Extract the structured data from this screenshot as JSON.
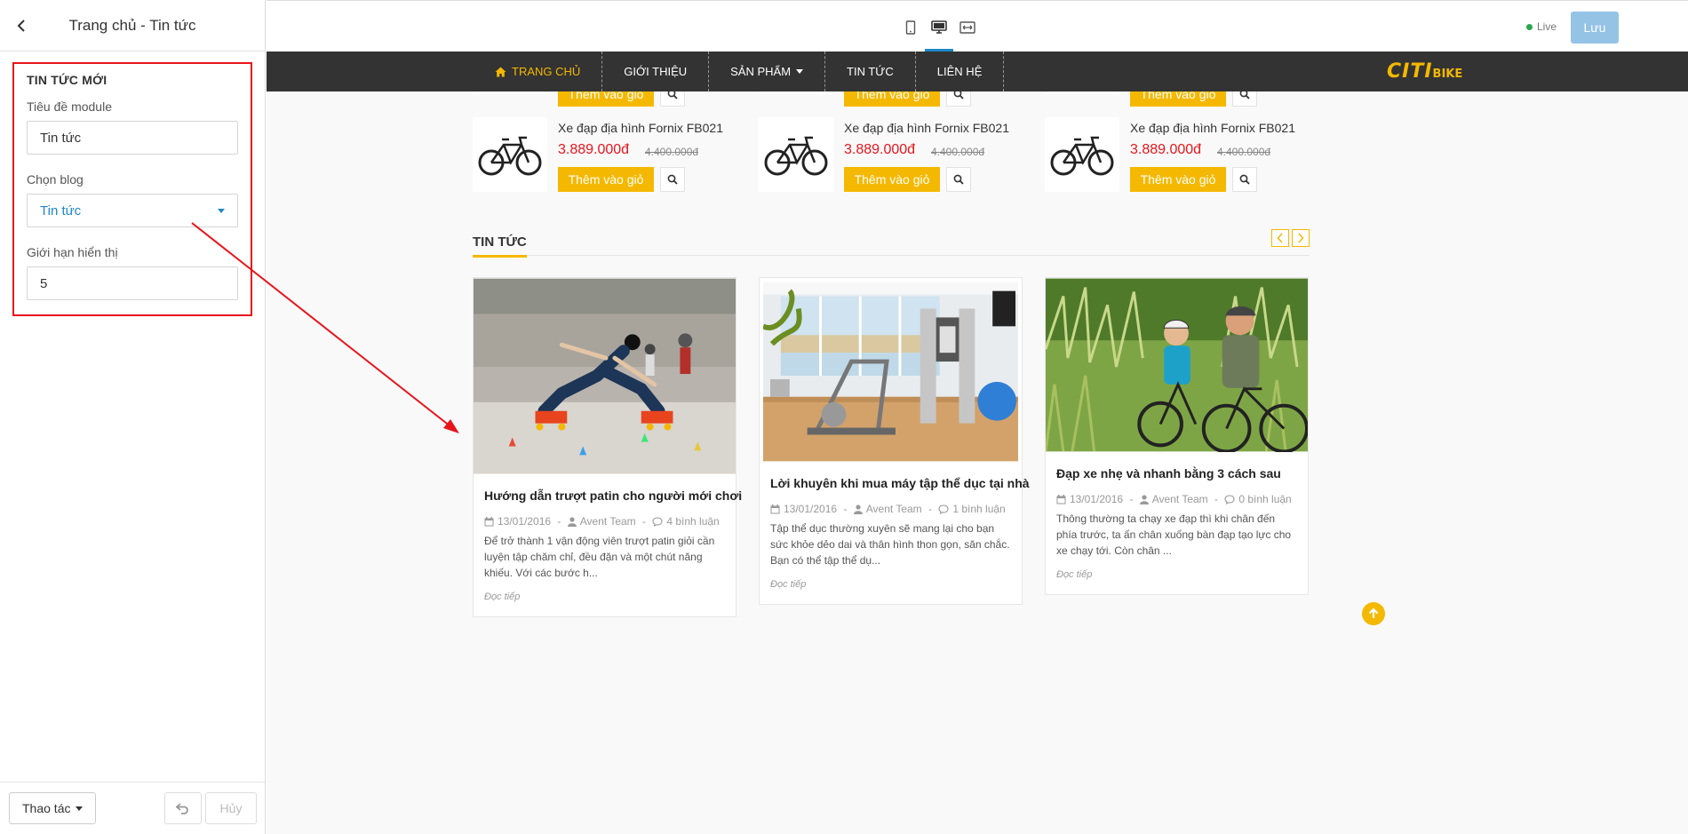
{
  "editor": {
    "title": "Trang chủ - Tin tức",
    "section_title": "TIN TỨC MỚI",
    "fields": {
      "module_title_label": "Tiêu đề module",
      "module_title_value": "Tin tức",
      "blog_label": "Chọn blog",
      "blog_value": "Tin tức",
      "limit_label": "Giới hạn hiển thị",
      "limit_value": "5"
    },
    "footer": {
      "action_label": "Thao tác",
      "cancel_label": "Hủy"
    }
  },
  "toolbar": {
    "status": "Live",
    "save_label": "Lưu"
  },
  "site": {
    "nav": [
      {
        "label": "TRANG CHỦ",
        "active": true
      },
      {
        "label": "GIỚI THIỆU"
      },
      {
        "label": "SẢN PHẨM",
        "dropdown": true
      },
      {
        "label": "TIN TỨC"
      },
      {
        "label": "LIÊN HỆ"
      }
    ],
    "logo": {
      "part1": "CITI",
      "part2": "BIKE"
    },
    "products_top": [
      {
        "button": "Thêm vào giỏ"
      },
      {
        "button": "Thêm vào giỏ"
      },
      {
        "button": "Thêm vào giỏ"
      }
    ],
    "products": [
      {
        "name": "Xe đạp địa hình Fornix FB021",
        "price": "3.889.000đ",
        "old_price": "4.400.000đ",
        "button": "Thêm vào giỏ"
      },
      {
        "name": "Xe đạp địa hình Fornix FB021",
        "price": "3.889.000đ",
        "old_price": "4.400.000đ",
        "button": "Thêm vào giỏ"
      },
      {
        "name": "Xe đạp địa hình Fornix FB021",
        "price": "3.889.000đ",
        "old_price": "4.400.000đ",
        "button": "Thêm vào giỏ"
      }
    ],
    "news_title": "TIN TỨC",
    "articles": [
      {
        "title": "Hướng dẫn trượt patin cho người mới chơi",
        "date": "13/01/2016",
        "author": "Avent Team",
        "comments": "4 bình luận",
        "excerpt": "Để trở thành 1 vận động viên trượt patin giỏi cần luyện tập chăm chỉ, đều đặn và một chút năng khiếu. Với các bước h...",
        "more": "Đọc tiếp"
      },
      {
        "title": "Lời khuyên khi mua máy tập thể dục tại nhà",
        "date": "13/01/2016",
        "author": "Avent Team",
        "comments": "1 bình luận",
        "excerpt": "Tập thể dục thường xuyên sẽ mang lại cho bạn sức khỏe dẻo dai và thân hình thon gọn, săn chắc. Bạn có thể tập thể dụ...",
        "more": "Đọc tiếp"
      },
      {
        "title": "Đạp xe nhẹ và nhanh bằng 3 cách sau",
        "date": "13/01/2016",
        "author": "Avent Team",
        "comments": "0 bình luận",
        "excerpt": "Thông thường ta chạy xe đạp thì khi chân đến phía trước, ta ấn chân xuống bàn đạp tạo lực cho xe chạy tới. Còn chân ...",
        "more": "Đọc tiếp"
      }
    ]
  },
  "colors": {
    "accent": "#f5b800",
    "price": "#e8141b",
    "navbar": "#333333",
    "annotation": "#e8141b",
    "save_button": "#95c3e6",
    "link_blue": "#1e88c7"
  }
}
